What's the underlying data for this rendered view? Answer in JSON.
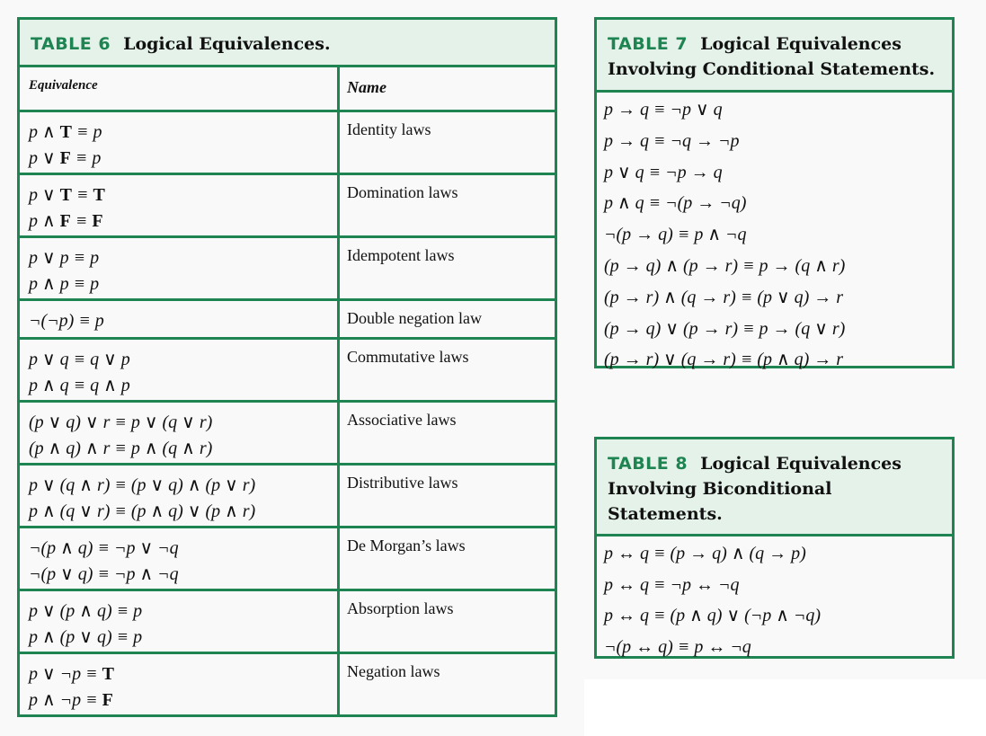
{
  "table6": {
    "number": "TABLE 6",
    "title": "Logical Equivalences.",
    "headers": {
      "equivalence": "Equivalence",
      "name": "Name"
    },
    "rows": [
      {
        "equivalences": [
          "p ∧ T ≡ p",
          "p ∨ F ≡ p"
        ],
        "name": "Identity laws"
      },
      {
        "equivalences": [
          "p ∨ T ≡ T",
          "p ∧ F ≡ F"
        ],
        "name": "Domination laws"
      },
      {
        "equivalences": [
          "p ∨ p ≡ p",
          "p ∧ p ≡ p"
        ],
        "name": "Idempotent laws"
      },
      {
        "equivalences": [
          "¬(¬p) ≡ p"
        ],
        "name": "Double negation law"
      },
      {
        "equivalences": [
          "p ∨ q ≡ q ∨ p",
          "p ∧ q ≡ q ∧ p"
        ],
        "name": "Commutative laws"
      },
      {
        "equivalences": [
          "(p ∨ q) ∨ r ≡ p ∨ (q ∨ r)",
          "(p ∧ q) ∧ r ≡ p ∧ (q ∧ r)"
        ],
        "name": "Associative laws"
      },
      {
        "equivalences": [
          "p ∨ (q ∧ r) ≡ (p ∨ q) ∧ (p ∨ r)",
          "p ∧ (q ∨ r) ≡ (p ∧ q) ∨ (p ∧ r)"
        ],
        "name": "Distributive laws"
      },
      {
        "equivalences": [
          "¬(p ∧ q) ≡ ¬p ∨ ¬q",
          "¬(p ∨ q) ≡ ¬p ∧ ¬q"
        ],
        "name": "De Morgan’s laws"
      },
      {
        "equivalences": [
          "p ∨ (p ∧ q) ≡ p",
          "p ∧ (p ∨ q) ≡ p"
        ],
        "name": "Absorption laws"
      },
      {
        "equivalences": [
          "p ∨ ¬p ≡ T",
          "p ∧ ¬p ≡ F"
        ],
        "name": "Negation laws"
      }
    ]
  },
  "table7": {
    "number": "TABLE 7",
    "title": "Logical Equivalences Involving Conditional Statements.",
    "equivalences": [
      "p → q ≡ ¬p ∨ q",
      "p → q ≡ ¬q → ¬p",
      "p ∨ q ≡ ¬p → q",
      "p ∧ q ≡ ¬(p → ¬q)",
      "¬(p → q) ≡ p ∧ ¬q",
      "(p → q) ∧ (p → r) ≡ p → (q ∧ r)",
      "(p → r) ∧ (q → r) ≡ (p ∨ q) → r",
      "(p → q) ∨ (p → r) ≡ p → (q ∨ r)",
      "(p → r) ∨ (q → r) ≡ (p ∧ q) → r"
    ]
  },
  "table8": {
    "number": "TABLE 8",
    "title": "Logical Equivalences Involving Biconditional Statements.",
    "equivalences": [
      "p ↔ q ≡ (p → q) ∧ (q → p)",
      "p ↔ q ≡ ¬p ↔ ¬q",
      "p ↔ q ≡ (p ∧ q) ∨ (¬p ∧ ¬q)",
      "¬(p ↔ q) ≡ p ↔ ¬q"
    ]
  },
  "colors": {
    "accent": "#1e8452",
    "header_bg": "#e5f2e9",
    "page_bg": "#f9f9f9"
  }
}
